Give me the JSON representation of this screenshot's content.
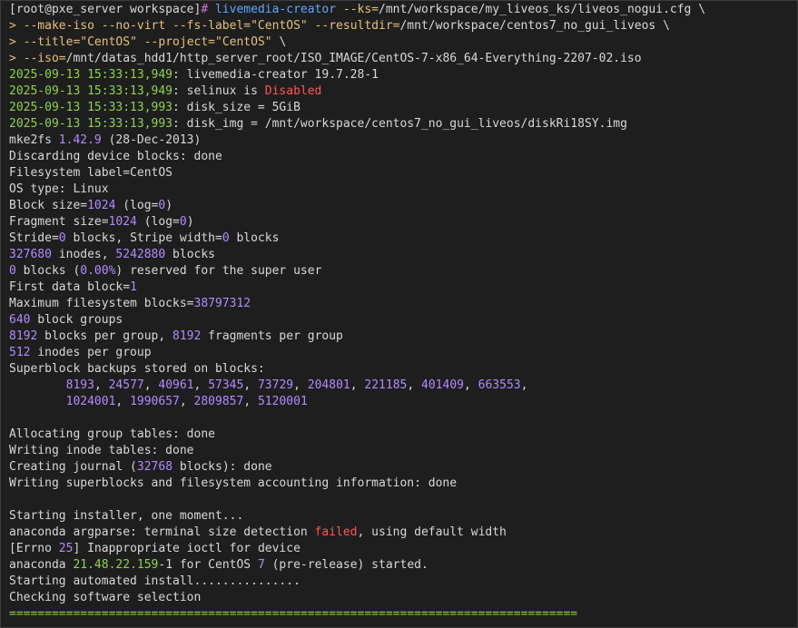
{
  "terminal": {
    "colors": {
      "background": "#1e1e1e",
      "text": "#d8d8d8",
      "prompt_brackets": "#d8d8d8",
      "prompt_hash": "#c678dd",
      "command": "#5fa8ff",
      "continuation": "#e5c07b",
      "string": "#e5c07b",
      "number": "#b08cff",
      "timestamp": "#8fd14f",
      "error": "#ff5555",
      "version": "#8fd14f",
      "punct": "#b08cff"
    },
    "lines": [
      [
        [
          "[root@pxe_server workspace]",
          "prompt"
        ],
        [
          "# ",
          "hash"
        ],
        [
          "livemedia-creator ",
          "cmd"
        ],
        [
          "--ks=",
          "flag"
        ],
        [
          "/mnt/workspace/my_liveos_ks/liveos_nogui.cfg \\",
          "text"
        ]
      ],
      [
        [
          "> ",
          "cont"
        ],
        [
          "--make-iso --no-virt --fs-label=",
          "flag"
        ],
        [
          "\"CentOS\"",
          "str"
        ],
        [
          " --resultdir=",
          "flag"
        ],
        [
          "/mnt/workspace/centos7_no_gui_liveos \\",
          "text"
        ]
      ],
      [
        [
          "> ",
          "cont"
        ],
        [
          "--title=",
          "flag"
        ],
        [
          "\"CentOS\"",
          "str"
        ],
        [
          " --project=",
          "flag"
        ],
        [
          "\"CentOS\"",
          "str"
        ],
        [
          " \\",
          "text"
        ]
      ],
      [
        [
          "> ",
          "cont"
        ],
        [
          "--iso=",
          "flag"
        ],
        [
          "/mnt/datas_hdd1/http_server_root/ISO_IMAGE/CentOS-7-x86_64-Everything-2207-02.iso",
          "text"
        ]
      ],
      [
        [
          "2025-09-13 15:33:13,949",
          "ts"
        ],
        [
          ": livemedia-creator 19.7.28-1",
          "text"
        ]
      ],
      [
        [
          "2025-09-13 15:33:13,949",
          "ts"
        ],
        [
          ": selinux is ",
          "text"
        ],
        [
          "Disabled",
          "err"
        ]
      ],
      [
        [
          "2025-09-13 15:33:13,993",
          "ts"
        ],
        [
          ": disk_size = 5GiB",
          "text"
        ]
      ],
      [
        [
          "2025-09-13 15:33:13,993",
          "ts"
        ],
        [
          ": disk_img = /mnt/workspace/centos7_no_gui_liveos/diskRi18SY.img",
          "text"
        ]
      ],
      [
        [
          "mke2fs ",
          "text"
        ],
        [
          "1.42.9",
          "num"
        ],
        [
          " (28-Dec-2013)",
          "text"
        ]
      ],
      [
        [
          "Discarding device blocks: done",
          "text"
        ]
      ],
      [
        [
          "Filesystem label=CentOS",
          "text"
        ]
      ],
      [
        [
          "OS type: Linux",
          "text"
        ]
      ],
      [
        [
          "Block size=",
          "text"
        ],
        [
          "1024",
          "num"
        ],
        [
          " (log=",
          "text"
        ],
        [
          "0",
          "num"
        ],
        [
          ")",
          "text"
        ]
      ],
      [
        [
          "Fragment size=",
          "text"
        ],
        [
          "1024",
          "num"
        ],
        [
          " (log=",
          "text"
        ],
        [
          "0",
          "num"
        ],
        [
          ")",
          "text"
        ]
      ],
      [
        [
          "Stride=",
          "text"
        ],
        [
          "0",
          "num"
        ],
        [
          " blocks, Stripe width=",
          "text"
        ],
        [
          "0",
          "num"
        ],
        [
          " blocks",
          "text"
        ]
      ],
      [
        [
          "327680",
          "num"
        ],
        [
          " inodes, ",
          "text"
        ],
        [
          "5242880",
          "num"
        ],
        [
          " blocks",
          "text"
        ]
      ],
      [
        [
          "0",
          "num"
        ],
        [
          " blocks (",
          "text"
        ],
        [
          "0.00%",
          "num"
        ],
        [
          ") reserved for the super user",
          "text"
        ]
      ],
      [
        [
          "First data block=",
          "text"
        ],
        [
          "1",
          "num"
        ]
      ],
      [
        [
          "Maximum filesystem blocks=",
          "text"
        ],
        [
          "38797312",
          "num"
        ]
      ],
      [
        [
          "640",
          "num"
        ],
        [
          " block groups",
          "text"
        ]
      ],
      [
        [
          "8192",
          "num"
        ],
        [
          " blocks per group, ",
          "text"
        ],
        [
          "8192",
          "num"
        ],
        [
          " fragments per group",
          "text"
        ]
      ],
      [
        [
          "512",
          "num"
        ],
        [
          " inodes per group",
          "text"
        ]
      ],
      [
        [
          "Superblock backups stored on blocks:",
          "text"
        ]
      ],
      [
        [
          "        ",
          "text"
        ],
        [
          "8193",
          "num"
        ],
        [
          ", ",
          "text"
        ],
        [
          "24577",
          "num"
        ],
        [
          ", ",
          "text"
        ],
        [
          "40961",
          "num"
        ],
        [
          ", ",
          "text"
        ],
        [
          "57345",
          "num"
        ],
        [
          ", ",
          "text"
        ],
        [
          "73729",
          "num"
        ],
        [
          ", ",
          "text"
        ],
        [
          "204801",
          "num"
        ],
        [
          ", ",
          "text"
        ],
        [
          "221185",
          "num"
        ],
        [
          ", ",
          "text"
        ],
        [
          "401409",
          "num"
        ],
        [
          ", ",
          "text"
        ],
        [
          "663553",
          "num"
        ],
        [
          ",",
          "text"
        ]
      ],
      [
        [
          "        ",
          "text"
        ],
        [
          "1024001",
          "num"
        ],
        [
          ", ",
          "text"
        ],
        [
          "1990657",
          "num"
        ],
        [
          ", ",
          "text"
        ],
        [
          "2809857",
          "num"
        ],
        [
          ", ",
          "text"
        ],
        [
          "5120001",
          "num"
        ]
      ],
      [
        [
          "",
          "text"
        ]
      ],
      [
        [
          "Allocating group tables: done",
          "text"
        ]
      ],
      [
        [
          "Writing inode tables: done",
          "text"
        ]
      ],
      [
        [
          "Creating journal (",
          "text"
        ],
        [
          "32768",
          "num"
        ],
        [
          " blocks): done",
          "text"
        ]
      ],
      [
        [
          "Writing superblocks and filesystem accounting information: done",
          "text"
        ]
      ],
      [
        [
          "",
          "text"
        ]
      ],
      [
        [
          "Starting installer, one moment...",
          "text"
        ]
      ],
      [
        [
          "anaconda argparse: terminal size detection ",
          "text"
        ],
        [
          "failed",
          "err"
        ],
        [
          ", using default width",
          "text"
        ]
      ],
      [
        [
          "[Errno ",
          "text"
        ],
        [
          "25",
          "num"
        ],
        [
          "] Inappropriate ioctl for device",
          "text"
        ]
      ],
      [
        [
          "anaconda ",
          "text"
        ],
        [
          "21.48.22.159",
          "ver"
        ],
        [
          "-1 for CentOS ",
          "text"
        ],
        [
          "7",
          "num"
        ],
        [
          " (pre-release) started.",
          "text"
        ]
      ],
      [
        [
          "Starting automated install...............",
          "text"
        ]
      ],
      [
        [
          "Checking software selection",
          "text"
        ]
      ],
      [
        [
          "================================================================================",
          "ts"
        ]
      ]
    ]
  }
}
